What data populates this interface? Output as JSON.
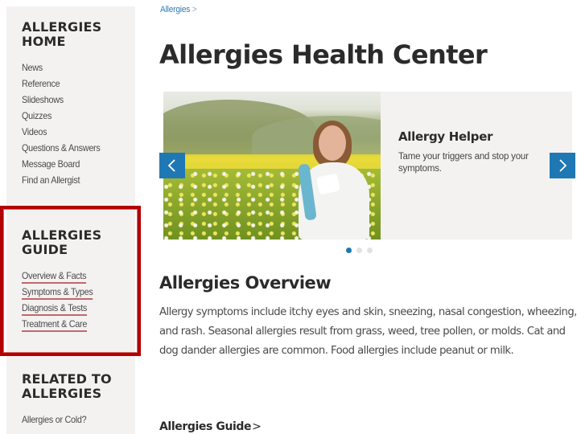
{
  "sidebar": {
    "home": {
      "heading_line1": "ALLERGIES",
      "heading_line2": "HOME",
      "items": [
        {
          "label": "News"
        },
        {
          "label": "Reference"
        },
        {
          "label": "Slideshows"
        },
        {
          "label": "Quizzes"
        },
        {
          "label": "Videos"
        },
        {
          "label": "Questions & Answers"
        },
        {
          "label": "Message Board"
        },
        {
          "label": "Find an Allergist"
        }
      ]
    },
    "guide": {
      "heading_line1": "ALLERGIES",
      "heading_line2": "GUIDE",
      "items": [
        {
          "label": "Overview & Facts"
        },
        {
          "label": "Symptoms & Types"
        },
        {
          "label": "Diagnosis & Tests"
        },
        {
          "label": "Treatment & Care"
        }
      ],
      "highlight_color": "#b30000",
      "underline_color": "#c0686c"
    },
    "related": {
      "heading_line1": "RELATED TO",
      "heading_line2": "ALLERGIES",
      "items": [
        {
          "label": "Allergies or Cold?"
        }
      ]
    }
  },
  "breadcrumb": {
    "items": [
      {
        "label": "Allergies"
      }
    ],
    "separator": ">"
  },
  "page": {
    "title": "Allergies Health Center"
  },
  "carousel": {
    "slide": {
      "image_alt": "Woman sneezing in a dandelion meadow",
      "title": "Allergy Helper",
      "text": "Tame your triggers and stop your symptoms."
    },
    "prev_icon": "chevron-left-icon",
    "next_icon": "chevron-right-icon",
    "slide_count": 3,
    "active_index": 0,
    "accent_color": "#1f78b4"
  },
  "overview": {
    "title": "Allergies Overview",
    "text": "Allergy symptoms include itchy eyes and skin, sneezing, nasal congestion, wheezing, and rash. Seasonal allergies result from grass, weed, tree pollen, or molds. Cat and dog dander allergies are common. Food allergies include peanut or milk."
  },
  "guide_link": {
    "label": "Allergies Guide",
    "chevron": ">"
  }
}
